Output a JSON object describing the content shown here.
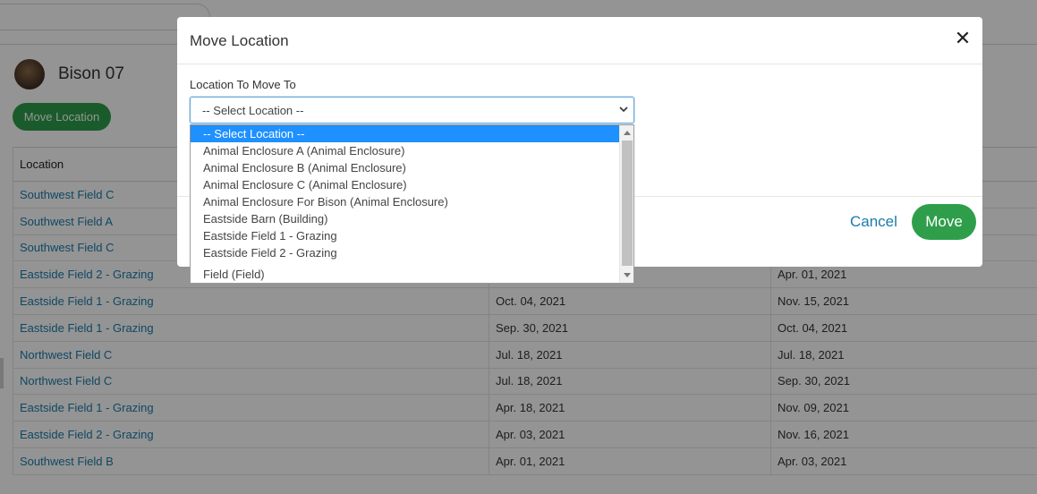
{
  "animal": {
    "name": "Bison 07"
  },
  "page": {
    "move_button_label": "Move Location"
  },
  "table": {
    "headers": [
      "Location",
      "",
      ""
    ],
    "rows": [
      {
        "location": "Southwest Field C",
        "moved_in": "",
        "moved_out": ""
      },
      {
        "location": "Southwest Field A",
        "moved_in": "",
        "moved_out": ""
      },
      {
        "location": "Southwest Field C",
        "moved_in": "",
        "moved_out": ""
      },
      {
        "location": "Eastside Field 2 - Grazing",
        "moved_in": "",
        "moved_out": "Apr. 01, 2021"
      },
      {
        "location": "Eastside Field 1 - Grazing",
        "moved_in": "Oct. 04, 2021",
        "moved_out": "Nov. 15, 2021"
      },
      {
        "location": "Eastside Field 1 - Grazing",
        "moved_in": "Sep. 30, 2021",
        "moved_out": "Oct. 04, 2021"
      },
      {
        "location": "Northwest Field C",
        "moved_in": "Jul. 18, 2021",
        "moved_out": "Jul. 18, 2021"
      },
      {
        "location": "Northwest Field C",
        "moved_in": "Jul. 18, 2021",
        "moved_out": "Sep. 30, 2021"
      },
      {
        "location": "Eastside Field 1 - Grazing",
        "moved_in": "Apr. 18, 2021",
        "moved_out": "Nov. 09, 2021"
      },
      {
        "location": "Eastside Field 2 - Grazing",
        "moved_in": "Apr. 03, 2021",
        "moved_out": "Nov. 16, 2021"
      },
      {
        "location": "Southwest Field B",
        "moved_in": "Apr. 01, 2021",
        "moved_out": "Apr. 03, 2021"
      }
    ]
  },
  "modal": {
    "title": "Move Location",
    "close_icon": "close-icon",
    "field_label": "Location To Move To",
    "selected_value": "-- Select Location --",
    "cancel_label": "Cancel",
    "submit_label": "Move"
  },
  "dropdown": {
    "options": [
      "-- Select Location --",
      "Animal Enclosure A (Animal Enclosure)",
      "Animal Enclosure B (Animal Enclosure)",
      "Animal Enclosure C (Animal Enclosure)",
      "Animal Enclosure For Bison (Animal Enclosure)",
      "Eastside Barn (Building)",
      "Eastside Field 1 - Grazing",
      "Eastside Field 2 - Grazing",
      "Field (Field)"
    ]
  },
  "colors": {
    "primary_green": "#2e9e4a",
    "link_blue": "#1a7cab",
    "highlight_blue": "#1e90ff"
  }
}
